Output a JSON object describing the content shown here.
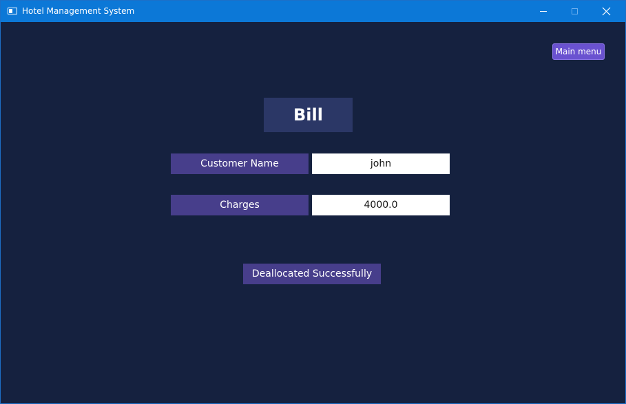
{
  "window": {
    "title": "Hotel Management System",
    "icons": {
      "app": "app-window-icon",
      "minimize": "minimize-icon",
      "maximize": "maximize-icon",
      "close": "close-icon"
    }
  },
  "colors": {
    "titlebar": "#0c78d7",
    "background": "#15213f",
    "title_panel": "#2b3766",
    "label_panel": "#473e8b",
    "main_menu_button": "#6a52d0",
    "value_field": "#ffffff"
  },
  "header": {
    "main_menu_label": "Main menu"
  },
  "bill": {
    "title": "Bill",
    "customer_name_label": "Customer Name",
    "customer_name_value": "john",
    "charges_label": "Charges",
    "charges_value": "4000.0",
    "status_message": "Deallocated Successfully"
  }
}
